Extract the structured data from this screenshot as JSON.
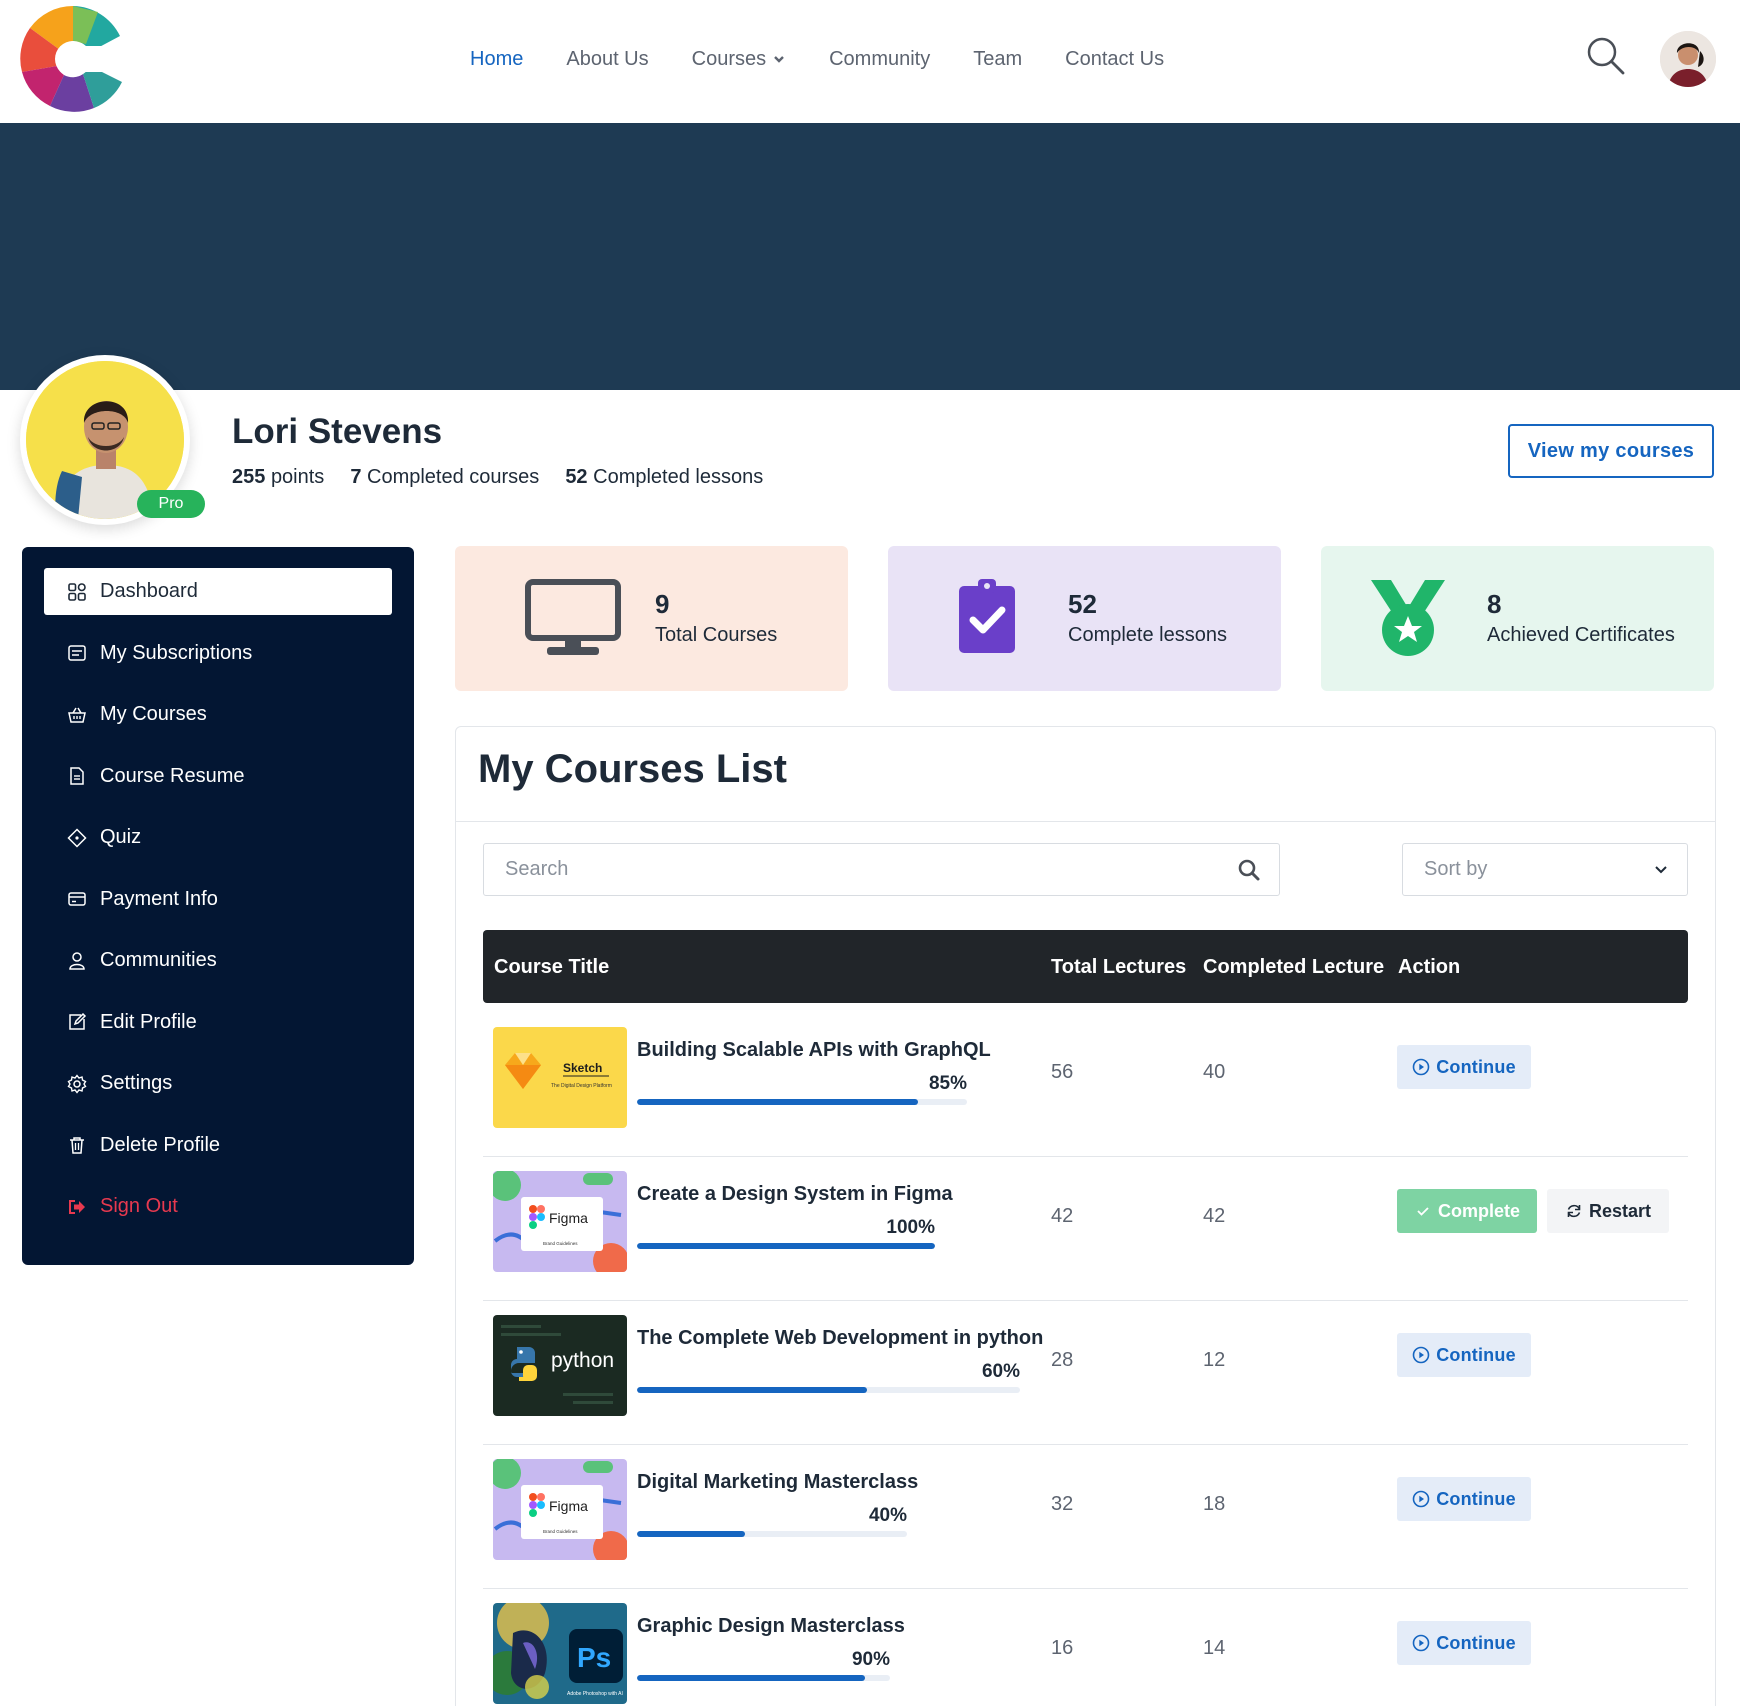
{
  "header": {
    "nav": [
      {
        "label": "Home",
        "active": true
      },
      {
        "label": "About Us"
      },
      {
        "label": "Courses",
        "dropdown": true
      },
      {
        "label": "Community"
      },
      {
        "label": "Team"
      },
      {
        "label": "Contact Us"
      }
    ],
    "icons": {
      "search": "search-icon",
      "avatar": "user-avatar"
    }
  },
  "profile": {
    "name": "Lori Stevens",
    "badge": "Pro",
    "points_value": "255",
    "points_label": "points",
    "courses_value": "7",
    "courses_label": "Completed courses",
    "lessons_value": "52",
    "lessons_label": "Completed lessons",
    "view_courses_button": "View my courses"
  },
  "sidebar": {
    "items": [
      {
        "label": "Dashboard",
        "icon": "dashboard-icon",
        "active": true
      },
      {
        "label": "My Subscriptions",
        "icon": "subscriptions-icon"
      },
      {
        "label": "My Courses",
        "icon": "basket-icon"
      },
      {
        "label": "Course Resume",
        "icon": "document-icon"
      },
      {
        "label": "Quiz",
        "icon": "quiz-icon"
      },
      {
        "label": "Payment Info",
        "icon": "credit-card-icon"
      },
      {
        "label": "Communities",
        "icon": "person-icon"
      },
      {
        "label": "Edit Profile",
        "icon": "edit-icon"
      },
      {
        "label": "Settings",
        "icon": "gear-icon"
      },
      {
        "label": "Delete Profile",
        "icon": "trash-icon"
      },
      {
        "label": "Sign Out",
        "icon": "sign-out-icon"
      }
    ]
  },
  "stats": [
    {
      "value": "9",
      "label": "Total Courses",
      "icon": "monitor-icon",
      "bg": "#fce9e0"
    },
    {
      "value": "52",
      "label": "Complete lessons",
      "icon": "clipboard-check-icon",
      "bg": "#e9e3f6"
    },
    {
      "value": "8",
      "label": "Achieved Certificates",
      "icon": "medal-icon",
      "bg": "#e6f6ee"
    }
  ],
  "courses_list": {
    "title": "My Courses List",
    "search_placeholder": "Search",
    "sort_placeholder": "Sort by",
    "headers": {
      "title": "Course Title",
      "total": "Total Lectures",
      "completed": "Completed Lecture",
      "action": "Action"
    },
    "rows": [
      {
        "title": "Building Scalable APIs with GraphQL",
        "percent": "85%",
        "progress": 0.85,
        "total": "56",
        "completed": "40",
        "action": "Continue",
        "thumb": "sketch-thumbnail"
      },
      {
        "title": "Create a Design System in Figma",
        "percent": "100%",
        "progress": 1.0,
        "total": "42",
        "completed": "42",
        "action": "Complete",
        "secondary_action": "Restart",
        "thumb": "figma-thumbnail"
      },
      {
        "title": "The Complete Web Development in python",
        "percent": "60%",
        "progress": 0.6,
        "total": "28",
        "completed": "12",
        "action": "Continue",
        "thumb": "python-thumbnail"
      },
      {
        "title": "Digital Marketing Masterclass",
        "percent": "40%",
        "progress": 0.4,
        "total": "32",
        "completed": "18",
        "action": "Continue",
        "thumb": "figma-thumbnail"
      },
      {
        "title": "Graphic Design Masterclass",
        "percent": "90%",
        "progress": 0.9,
        "total": "16",
        "completed": "14",
        "action": "Continue",
        "thumb": "photoshop-thumbnail"
      }
    ],
    "thumb_text": {
      "sketch": "Sketch",
      "sketch_sub": "The Digital Design Platform",
      "figma": "Figma",
      "figma_sub": "Brand Guidelines",
      "python": "python",
      "ps": "Ps",
      "ps_sub": "Adobe Photoshop with AI"
    }
  },
  "colors": {
    "accent": "#1565c0",
    "banner": "#1e3a53",
    "sidebar": "#031633",
    "success": "#27b35b",
    "danger": "#e8394f"
  }
}
